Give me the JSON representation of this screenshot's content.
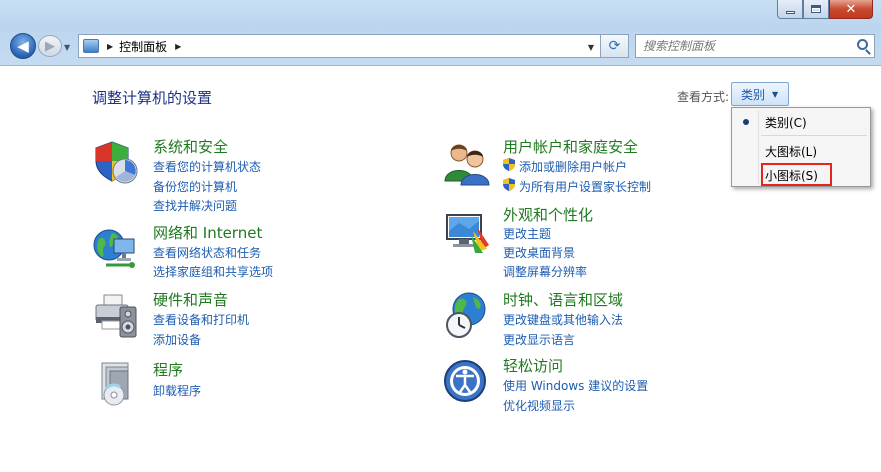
{
  "window": {
    "close_symbol": "✕"
  },
  "nav": {
    "back_symbol": "◀",
    "forward_symbol": "▶",
    "breadcrumb": [
      "控制面板"
    ],
    "refresh_symbol": "⟳",
    "search_placeholder": "搜索控制面板"
  },
  "page": {
    "title": "调整计算机的设置",
    "view_by_label": "查看方式:",
    "view_by_value": "类别"
  },
  "view_menu": {
    "items": [
      {
        "label": "类别(C)",
        "selected": true
      },
      {
        "label": "大图标(L)",
        "selected": false
      },
      {
        "label": "小图标(S)",
        "selected": false,
        "highlighted": true
      }
    ],
    "highlight_color": "#e52520"
  },
  "categories": [
    {
      "title": "系统和安全",
      "icon": "system-security-icon",
      "links": [
        "查看您的计算机状态",
        "备份您的计算机",
        "查找并解决问题"
      ]
    },
    {
      "title": "网络和 Internet",
      "icon": "network-internet-icon",
      "links": [
        "查看网络状态和任务",
        "选择家庭组和共享选项"
      ]
    },
    {
      "title": "硬件和声音",
      "icon": "hardware-sound-icon",
      "links": [
        "查看设备和打印机",
        "添加设备"
      ]
    },
    {
      "title": "程序",
      "icon": "programs-icon",
      "links": [
        "卸载程序"
      ]
    },
    {
      "title": "用户帐户和家庭安全",
      "icon": "user-accounts-icon",
      "links": [
        "添加或删除用户帐户",
        "为所有用户设置家长控制"
      ]
    },
    {
      "title": "外观和个性化",
      "icon": "appearance-icon",
      "links": [
        "更改主题",
        "更改桌面背景",
        "调整屏幕分辨率"
      ]
    },
    {
      "title": "时钟、语言和区域",
      "icon": "clock-language-icon",
      "links": [
        "更改键盘或其他输入法",
        "更改显示语言"
      ]
    },
    {
      "title": "轻松访问",
      "icon": "ease-of-access-icon",
      "links": [
        "使用 Windows 建议的设置",
        "优化视频显示"
      ]
    }
  ],
  "colors": {
    "title_green": "#1f7a1f",
    "link_blue": "#1e5db0",
    "heading_blue": "#1e3287"
  }
}
